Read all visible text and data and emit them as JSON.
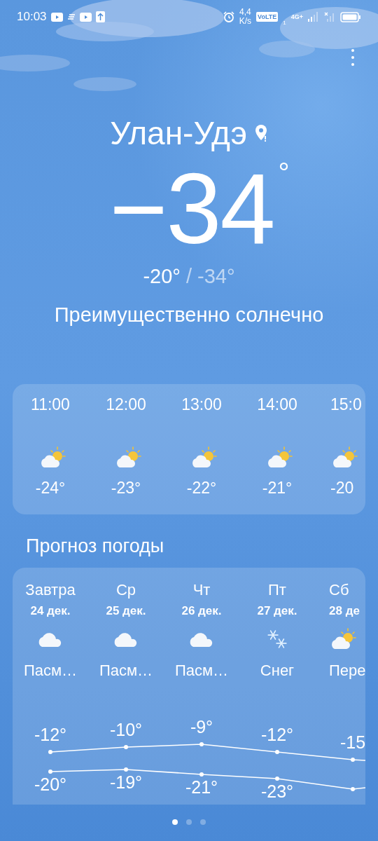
{
  "status_bar": {
    "time": "10:03",
    "speed_value": "4,4",
    "speed_unit": "K/s",
    "volte": "VoLTE",
    "sim": "1",
    "network": "4G+"
  },
  "city": "Улан-Удэ",
  "temperature": "−34",
  "degree": "°",
  "high": "-20°",
  "separator": "/",
  "low": "-34°",
  "condition": "Преимущественно солнечно",
  "hourly": [
    {
      "time": "11:00",
      "kind": "partly_cloudy",
      "temp": "-24°"
    },
    {
      "time": "12:00",
      "kind": "partly_cloudy",
      "temp": "-23°"
    },
    {
      "time": "13:00",
      "kind": "partly_cloudy",
      "temp": "-22°"
    },
    {
      "time": "14:00",
      "kind": "partly_cloudy",
      "temp": "-21°"
    },
    {
      "time": "15:0",
      "kind": "partly_cloudy",
      "temp": "-20"
    }
  ],
  "forecast_title": "Прогноз погоды",
  "daily": [
    {
      "day": "Завтра",
      "date": "24 дек.",
      "kind": "cloudy",
      "condition": "Пасм…",
      "high": "-12°",
      "low": "-20°"
    },
    {
      "day": "Ср",
      "date": "25 дек.",
      "kind": "cloudy",
      "condition": "Пасм…",
      "high": "-10°",
      "low": "-19°"
    },
    {
      "day": "Чт",
      "date": "26 дек.",
      "kind": "cloudy",
      "condition": "Пасм…",
      "high": "-9°",
      "low": "-21°"
    },
    {
      "day": "Пт",
      "date": "27 дек.",
      "kind": "snow",
      "condition": "Снег",
      "high": "-12°",
      "low": "-23°"
    },
    {
      "day": "Сб",
      "date": "28 де",
      "kind": "partly_cloudy",
      "condition": "Пере",
      "high": "-15"
    }
  ],
  "pages": [
    {
      "selected": true
    },
    {
      "selected": false
    },
    {
      "selected": false
    }
  ]
}
